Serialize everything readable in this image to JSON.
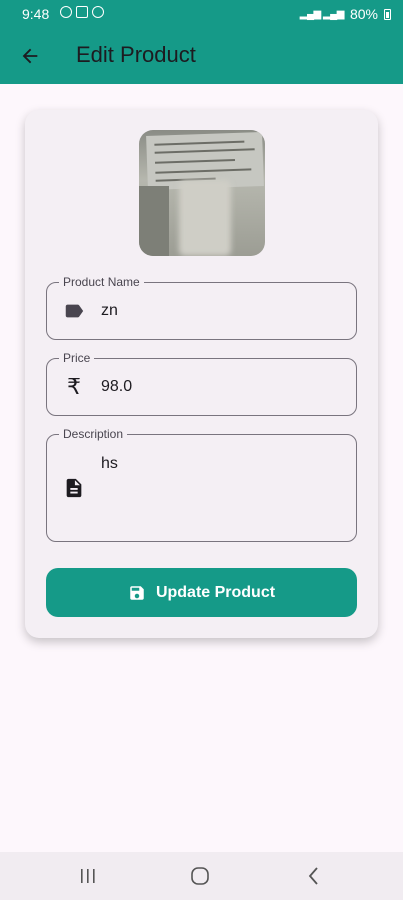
{
  "status_bar": {
    "time": "9:48",
    "battery": "80%"
  },
  "app_bar": {
    "title": "Edit Product"
  },
  "form": {
    "product_name": {
      "label": "Product Name",
      "value": "zn"
    },
    "price": {
      "label": "Price",
      "value": "98.0",
      "icon_glyph": "₹"
    },
    "description": {
      "label": "Description",
      "value": "hs"
    }
  },
  "update_button": {
    "label": "Update Product"
  },
  "colors": {
    "primary": "#159a88",
    "background": "#fdf7fc",
    "card": "#f4eff4"
  },
  "icons": [
    "arrow-back-icon",
    "label-tag-icon",
    "rupee-icon",
    "document-icon",
    "save-icon",
    "recents-icon",
    "home-icon",
    "back-nav-icon"
  ]
}
